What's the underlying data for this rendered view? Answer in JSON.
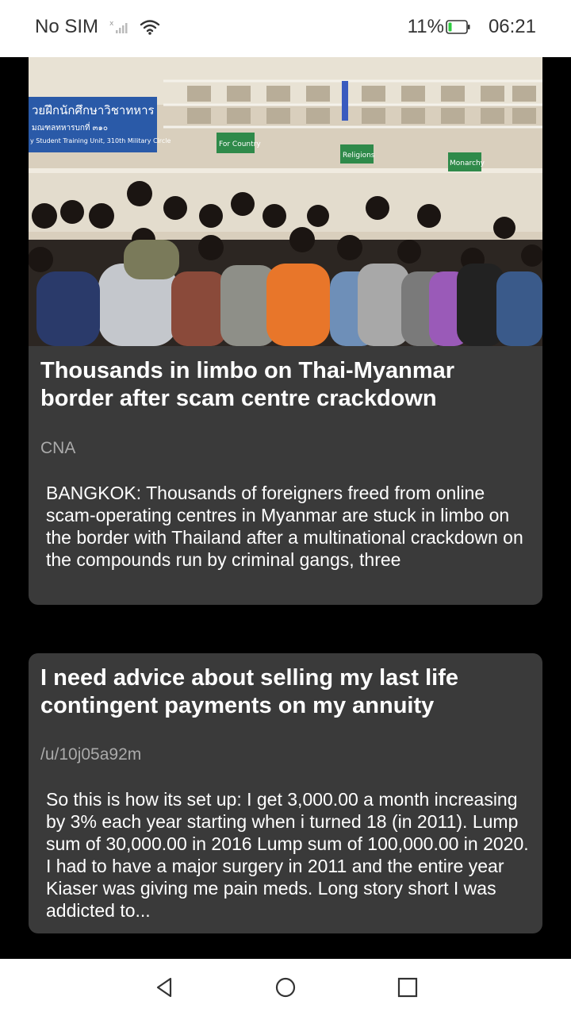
{
  "status_bar": {
    "carrier": "No SIM",
    "battery": "11%",
    "time": "06:21"
  },
  "feed": [
    {
      "title": "Thousands in limbo on Thai-Myanmar border after scam centre crackdown",
      "source": "CNA",
      "excerpt": "BANGKOK: Thousands of foreigners freed from online scam-operating centres in Myanmar are stuck in limbo on the border with Thailand after a multinational crackdown on the compounds run by criminal gangs, three",
      "image": {
        "building_sign_line1": "วยฝึกนักศึกษาวิชาทหาร",
        "building_sign_line2": "มณฑลทหารบกที่ ๓๑๐",
        "building_sign_line3": "y Student Training Unit, 310th Military Circle",
        "sign_for_country": "For Country",
        "sign_religions": "Religions",
        "sign_monarchy": "Monarchy"
      }
    },
    {
      "title": "I need advice about selling my last life contingent payments on my annuity",
      "source": "/u/10j05a92m",
      "excerpt": "So this is how its set up: I get 3,000.00 a month increasing by 3% each year starting when i turned 18 (in 2011). Lump sum of 30,000.00 in 2016 Lump sum of 100,000.00 in 2020. I had to have a major surgery in 2011 and the entire year Kiaser was giving me pain meds. Long story short I was addicted to..."
    }
  ],
  "nav": {
    "back_icon": "back-triangle-icon",
    "home_icon": "home-circle-icon",
    "recents_icon": "recents-square-icon"
  }
}
